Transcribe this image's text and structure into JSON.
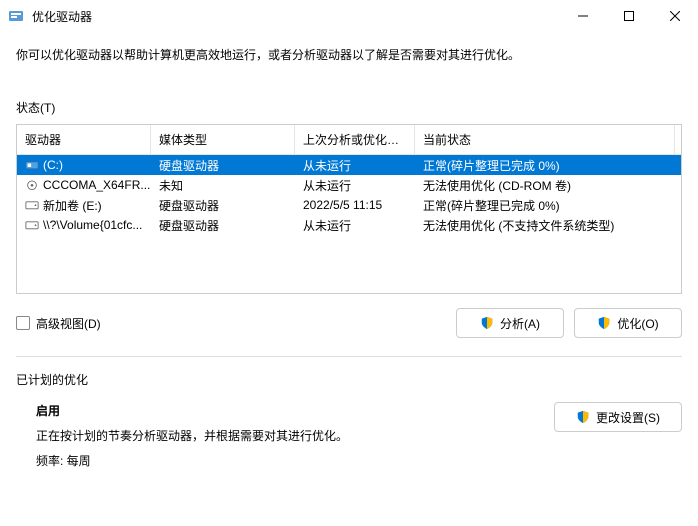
{
  "window": {
    "title": "优化驱动器"
  },
  "description": "你可以优化驱动器以帮助计算机更高效地运行，或者分析驱动器以了解是否需要对其进行优化。",
  "status_label": "状态(T)",
  "columns": {
    "c0": "驱动器",
    "c1": "媒体类型",
    "c2": "上次分析或优化的...",
    "c3": "当前状态"
  },
  "rows": [
    {
      "drive": "(C:)",
      "media": "硬盘驱动器",
      "last": "从未运行",
      "state": "正常(碎片整理已完成 0%)",
      "icon": "hdd-c",
      "selected": true
    },
    {
      "drive": "CCCOMA_X64FR...",
      "media": "未知",
      "last": "从未运行",
      "state": "无法使用优化 (CD-ROM 卷)",
      "icon": "cd",
      "selected": false
    },
    {
      "drive": "新加卷 (E:)",
      "media": "硬盘驱动器",
      "last": "2022/5/5 11:15",
      "state": "正常(碎片整理已完成 0%)",
      "icon": "hdd",
      "selected": false
    },
    {
      "drive": "\\\\?\\Volume{01cfc...",
      "media": "硬盘驱动器",
      "last": "从未运行",
      "state": "无法使用优化 (不支持文件系统类型)",
      "icon": "hdd",
      "selected": false
    }
  ],
  "advanced_view": "高级视图(D)",
  "buttons": {
    "analyze": "分析(A)",
    "optimize": "优化(O)",
    "change": "更改设置(S)"
  },
  "scheduled": {
    "title": "已计划的优化",
    "on": "启用",
    "desc": "正在按计划的节奏分析驱动器，并根据需要对其进行优化。",
    "freq": "频率: 每周"
  }
}
